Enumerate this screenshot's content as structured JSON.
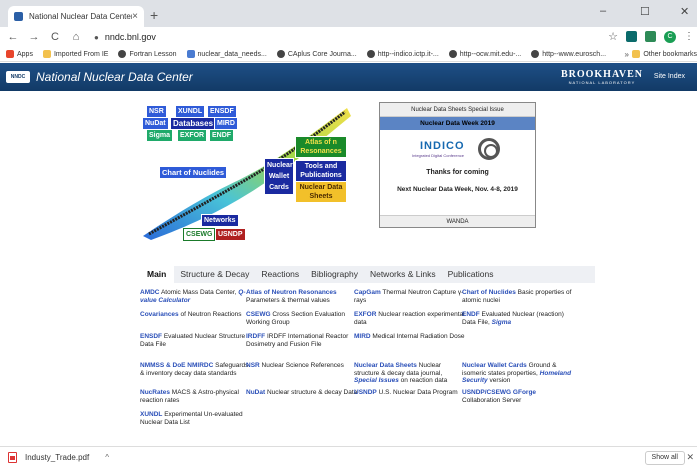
{
  "browser": {
    "tab_title": "National Nuclear Data Center",
    "tab_close": "×",
    "new_tab": "+",
    "win_min": "–",
    "win_max": "☐",
    "win_close": "✕",
    "back": "←",
    "forward": "→",
    "reload": "C",
    "home": "⌂",
    "url": "nndc.bnl.gov",
    "star": "☆",
    "profile": "C",
    "menu": "⋮",
    "bookmarks": [
      {
        "label": "Apps",
        "color": "#e8452c"
      },
      {
        "label": "Imported From IE",
        "color": "#f2c14e"
      },
      {
        "label": "Fortran Lesson",
        "color": "#444444"
      },
      {
        "label": "nuclear_data_needs...",
        "color": "#4a7bd1"
      },
      {
        "label": "CAplus Core Journa...",
        "color": "#444444"
      },
      {
        "label": "http--indico.ictp.it-...",
        "color": "#444444"
      },
      {
        "label": "http--ocw.mit.edu-...",
        "color": "#444444"
      },
      {
        "label": "http--www.eurosch...",
        "color": "#444444"
      }
    ],
    "bookmarks_more": "»",
    "other_bookmarks": "Other bookmarks"
  },
  "header": {
    "logo": "NNDC",
    "title": "National Nuclear Data Center",
    "bnl_name": "BROOKHAVEN",
    "bnl_sub": "NATIONAL LABORATORY",
    "site_index": "Site Index"
  },
  "map": {
    "nsr": "NSR",
    "xundl": "XUNDL",
    "ensdf": "ENSDF",
    "nudat": "NuDat",
    "databases": "Databases",
    "mird": "MIRD",
    "sigma": "Sigma",
    "exfor": "EXFOR",
    "endf": "ENDF",
    "chart": "Chart of Nuclides",
    "atlas": "Atlas of n Resonances",
    "tools": "Tools and Publications",
    "wallet": "Nuclear Wallet Cards",
    "datasheets": "Nuclear Data Sheets",
    "networks": "Networks",
    "csewg": "CSEWG",
    "usndp": "USNDP"
  },
  "special": {
    "head": "Nuclear Data Sheets Special Issue",
    "sub": "Nuclear Data Week 2019",
    "indico": "INDICO",
    "indico_sub": "Integrated Digital Conference",
    "thanks": "Thanks for coming",
    "next": "Next Nuclear Data Week, Nov. 4-8, 2019",
    "foot": "WANDA"
  },
  "tabs": [
    "Main",
    "Structure & Decay",
    "Reactions",
    "Bibliography",
    "Networks & Links",
    "Publications"
  ],
  "links": [
    {
      "name": "AMDC",
      "text": " Atomic Mass Data Center, ",
      "extra": "Q-value Calculator",
      "tail": ""
    },
    {
      "name": "Atlas of Neutron Resonances",
      "text": " Parameters & thermal values",
      "extra": "",
      "tail": ""
    },
    {
      "name": "CapGam",
      "text": " Thermal Neutron Capture γ-rays",
      "extra": "",
      "tail": ""
    },
    {
      "name": "Chart of Nuclides",
      "text": " Basic properties of atomic nuclei",
      "extra": "",
      "tail": ""
    },
    {
      "name": "Covariances",
      "text": " of Neutron Reactions",
      "extra": "",
      "tail": ""
    },
    {
      "name": "CSEWG",
      "text": " Cross Section Evaluation Working Group",
      "extra": "",
      "tail": ""
    },
    {
      "name": "EXFOR",
      "text": " Nuclear reaction experimental data",
      "extra": "",
      "tail": ""
    },
    {
      "name": "ENDF",
      "text": " Evaluated Nuclear (reaction) Data File, ",
      "extra": "Sigma",
      "tail": ""
    },
    {
      "name": "ENSDF",
      "text": " Evaluated Nuclear Structure Data File",
      "extra": "",
      "tail": ""
    },
    {
      "name": "IRDFF",
      "text": " IRDFF International Reactor Dosimetry and Fusion File",
      "extra": "",
      "tail": ""
    },
    {
      "name": "MIRD",
      "text": " Medical Internal Radiation Dose",
      "extra": "",
      "tail": ""
    },
    {
      "name": "",
      "text": "",
      "extra": "",
      "tail": ""
    },
    {
      "name": "NMMSS & DoE NMIRDC",
      "text": " Safeguards & inventory decay data standards",
      "extra": "",
      "tail": ""
    },
    {
      "name": "NSR",
      "text": " Nuclear Science References",
      "extra": "",
      "tail": ""
    },
    {
      "name": "Nuclear Data Sheets",
      "text": " Nuclear structure & decay data journal, ",
      "extra": "Special Issues",
      "tail": " on reaction data"
    },
    {
      "name": "Nuclear Wallet Cards",
      "text": " Ground & isomeric states properties, ",
      "extra": "Homeland Security",
      "tail": " version"
    },
    {
      "name": "NucRates",
      "text": " MACS & Astro-physical reaction rates",
      "extra": "",
      "tail": ""
    },
    {
      "name": "NuDat",
      "text": " Nuclear structure & decay Data",
      "extra": "",
      "tail": ""
    },
    {
      "name": "USNDP",
      "text": " U.S. Nuclear Data Program",
      "extra": "",
      "tail": ""
    },
    {
      "name": "USNDP/CSEWG GForge",
      "text": " Collaboration Server",
      "extra": "",
      "tail": ""
    },
    {
      "name": "XUNDL",
      "text": " Experimental Un-evaluated Nuclear Data List",
      "extra": "",
      "tail": ""
    }
  ],
  "download": {
    "file": "Industy_Trade.pdf",
    "caret": "^",
    "show_all": "Show all",
    "close": "✕"
  }
}
